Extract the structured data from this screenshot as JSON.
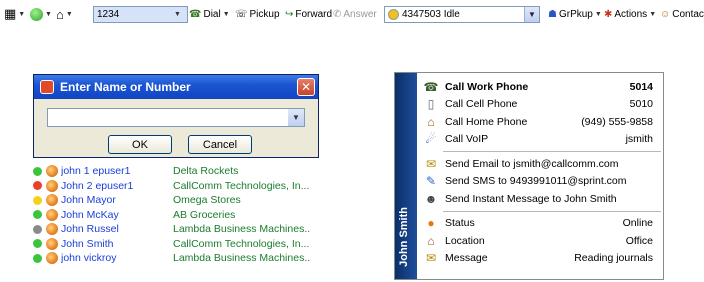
{
  "toolbar": {
    "phone_value": "1234",
    "dial_label": "Dial",
    "pickup_label": "Pickup",
    "forward_label": "Forward",
    "answer_label": "Answer",
    "line_status": "4347503 Idle",
    "grpkup_label": "GrPkup",
    "actions_label": "Actions",
    "contacts_label": "Contacts"
  },
  "dialog": {
    "title": "Enter Name or Number",
    "input_value": "",
    "ok_label": "OK",
    "cancel_label": "Cancel"
  },
  "contacts": [
    {
      "name": "john 1 epuser1",
      "company": "Delta Rockets",
      "status_color": "#3cc43c"
    },
    {
      "name": "John 2 epuser1",
      "company": "CallComm Technologies, In...",
      "status_color": "#e8402a"
    },
    {
      "name": "John Mayor",
      "company": "Omega Stores",
      "status_color": "#f2d21a"
    },
    {
      "name": "John McKay",
      "company": "AB Groceries",
      "status_color": "#3cc43c"
    },
    {
      "name": "John Russel",
      "company": "Lambda Business Machines...",
      "status_color": "#8a8a8a"
    },
    {
      "name": "John Smith",
      "company": "CallComm Technologies, In...",
      "status_color": "#3cc43c"
    },
    {
      "name": "john vickroy",
      "company": "Lambda Business Machines...",
      "status_color": "#3cc43c"
    }
  ],
  "popup": {
    "sidebar_title": "John Smith",
    "call_items": [
      {
        "label": "Call Work Phone",
        "value": "5014",
        "icon": "desk-phone-icon",
        "bold": true
      },
      {
        "label": "Call Cell Phone",
        "value": "5010",
        "icon": "cell-phone-icon",
        "bold": false
      },
      {
        "label": "Call Home Phone",
        "value": "(949) 555-9858",
        "icon": "home-icon",
        "bold": false
      },
      {
        "label": "Call VoIP",
        "value": "jsmith",
        "icon": "voip-icon",
        "bold": false
      }
    ],
    "send_items": [
      {
        "label": "Send Email to jsmith@callcomm.com",
        "icon": "email-icon"
      },
      {
        "label": "Send SMS to 9493991011@sprint.com",
        "icon": "sms-icon"
      },
      {
        "label": "Send Instant Message to John Smith",
        "icon": "instant-message-icon"
      }
    ],
    "info_items": [
      {
        "label": "Status",
        "value": "Online",
        "icon": "status-icon"
      },
      {
        "label": "Location",
        "value": "Office",
        "icon": "location-icon"
      },
      {
        "label": "Message",
        "value": "Reading journals",
        "icon": "message-icon"
      }
    ]
  }
}
